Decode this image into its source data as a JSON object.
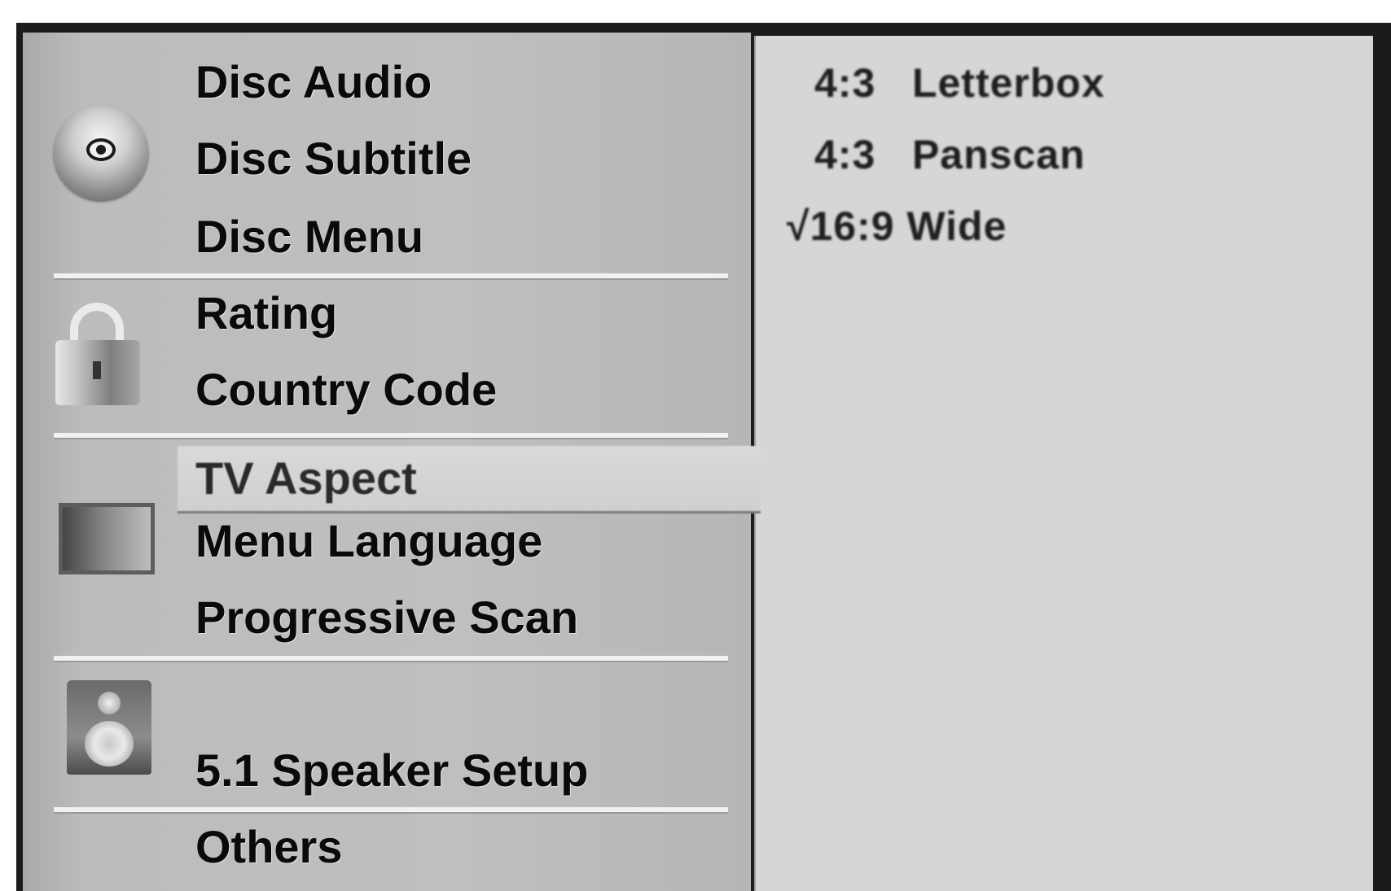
{
  "menu": {
    "items": [
      {
        "label": "Disc Audio"
      },
      {
        "label": "Disc Subtitle"
      },
      {
        "label": "Disc Menu"
      },
      {
        "label": "Rating"
      },
      {
        "label": "Country Code"
      },
      {
        "label": "TV Aspect"
      },
      {
        "label": "Menu Language"
      },
      {
        "label": "Progressive Scan"
      },
      {
        "label": "5.1 Speaker Setup"
      },
      {
        "label": "Others"
      }
    ],
    "selected": "TV Aspect"
  },
  "submenu": {
    "options": [
      {
        "label": "4:3   Letterbox"
      },
      {
        "label": "4:3   Panscan"
      },
      {
        "label": "√16:9 Wide"
      }
    ],
    "checked": "16:9 Wide"
  },
  "icons": [
    "disc-icon",
    "lock-icon",
    "tv-icon",
    "speaker-icon"
  ]
}
